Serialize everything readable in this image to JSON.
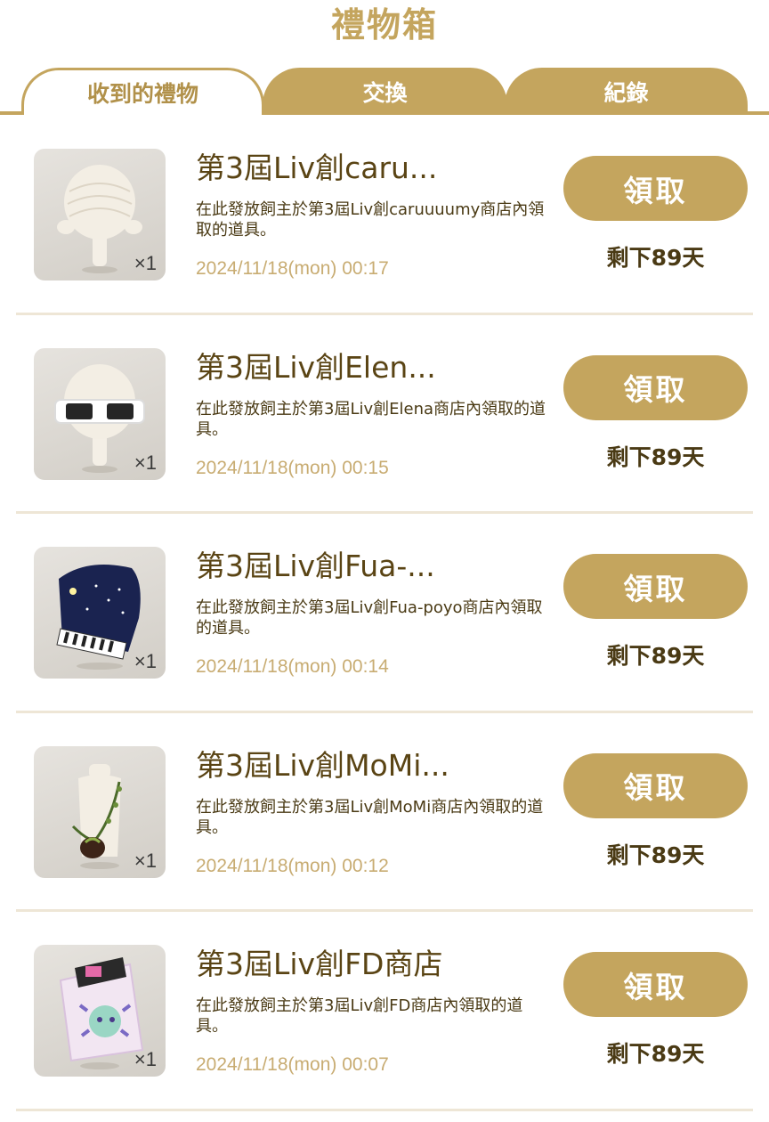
{
  "header": {
    "title": "禮物箱"
  },
  "tabs": [
    {
      "label": "收到的禮物",
      "active": true
    },
    {
      "label": "交換",
      "active": false
    },
    {
      "label": "紀錄",
      "active": false
    }
  ],
  "colors": {
    "accent": "#c4a55e",
    "text_dark": "#5a4414",
    "date": "#c8ac72",
    "divider": "#eee6d6"
  },
  "gifts": [
    {
      "title": "第3屆Liv創caru...",
      "desc": "在此發放飼主於第3屆Liv創caruuuumy商店內領取的道具。",
      "date": "2024/11/18(mon) 00:17",
      "qty": "×1",
      "button": "領取",
      "remaining": "剩下89天",
      "icon": "white-hair-icon"
    },
    {
      "title": "第3屆Liv創Elen...",
      "desc": "在此發放飼主於第3屆Liv創Elena商店內領取的道具。",
      "date": "2024/11/18(mon) 00:15",
      "qty": "×1",
      "button": "領取",
      "remaining": "剩下89天",
      "icon": "sunglasses-icon"
    },
    {
      "title": "第3屆Liv創Fua-...",
      "desc": "在此發放飼主於第3屆Liv創Fua-poyo商店內領取的道具。",
      "date": "2024/11/18(mon) 00:14",
      "qty": "×1",
      "button": "領取",
      "remaining": "剩下89天",
      "icon": "piano-icon"
    },
    {
      "title": "第3屆Liv創MoMi...",
      "desc": "在此發放飼主於第3屆Liv創MoMi商店內領取的道具。",
      "date": "2024/11/18(mon) 00:12",
      "qty": "×1",
      "button": "領取",
      "remaining": "剩下89天",
      "icon": "vine-bag-icon"
    },
    {
      "title": "第3屆Liv創FD商店",
      "desc": "在此發放飼主於第3屆Liv創FD商店內領取的道具。",
      "date": "2024/11/18(mon) 00:07",
      "qty": "×1",
      "button": "領取",
      "remaining": "剩下89天",
      "icon": "pouch-icon"
    }
  ]
}
